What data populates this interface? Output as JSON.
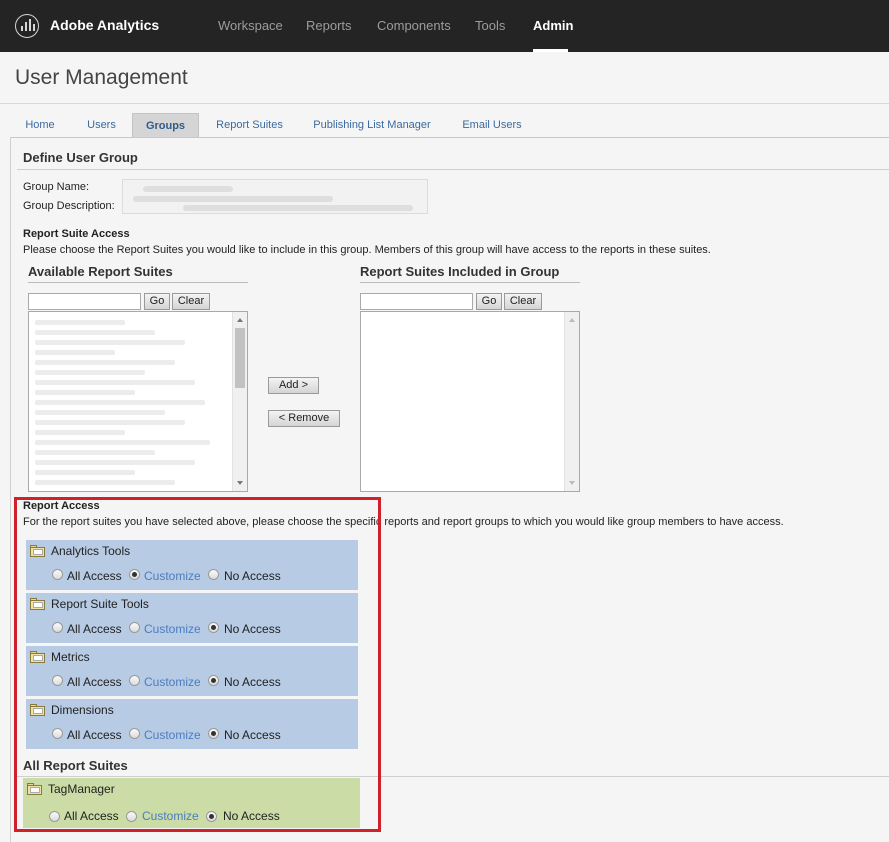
{
  "app": {
    "brand": "Adobe Analytics",
    "nav": [
      "Workspace",
      "Reports",
      "Components",
      "Tools",
      "Admin"
    ],
    "active_nav": "Admin"
  },
  "page": {
    "title": "User Management",
    "tabs": [
      "Home",
      "Users",
      "Groups",
      "Report Suites",
      "Publishing List Manager",
      "Email Users"
    ],
    "active_tab": "Groups"
  },
  "define_group": {
    "title": "Define User Group",
    "group_name_label": "Group Name:",
    "group_description_label": "Group Description:"
  },
  "report_suite_access": {
    "title": "Report Suite Access",
    "description": "Please choose the Report Suites you would like to include in this group. Members of this group will have access to the reports in these suites.",
    "available_heading": "Available Report Suites",
    "included_heading": "Report Suites Included in Group",
    "go_label": "Go",
    "clear_label": "Clear",
    "add_label": "Add >",
    "remove_label": "< Remove"
  },
  "report_access": {
    "title": "Report Access",
    "description": "For the report suites you have selected above, please choose the specific reports and report groups to which you would like group members to have access.",
    "options": [
      "All Access",
      "Customize",
      "No Access"
    ],
    "groups": [
      {
        "name": "Analytics Tools",
        "selected": "Customize"
      },
      {
        "name": "Report Suite Tools",
        "selected": "No Access"
      },
      {
        "name": "Metrics",
        "selected": "No Access"
      },
      {
        "name": "Dimensions",
        "selected": "No Access"
      }
    ]
  },
  "all_report_suites": {
    "title": "All Report Suites",
    "groups": [
      {
        "name": "TagManager",
        "selected": "No Access"
      }
    ]
  },
  "colors": {
    "topbar": "#242424",
    "group_block": "#b8cbe4",
    "all_suites_block": "#cbdca7",
    "highlight": "#d0202a",
    "link": "#4a7dc0"
  }
}
